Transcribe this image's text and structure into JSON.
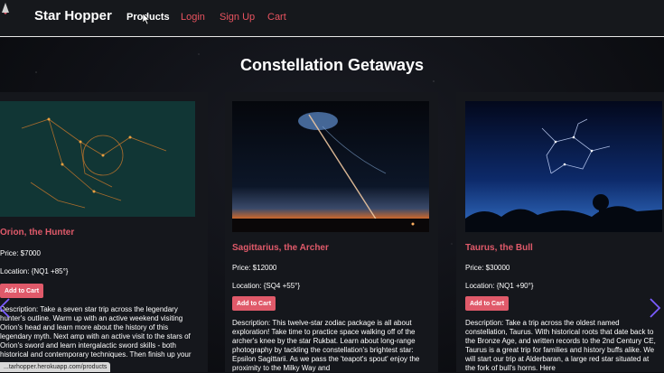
{
  "nav": {
    "brand": "Star Hopper",
    "links": [
      "Products",
      "Login",
      "Sign Up",
      "Cart"
    ],
    "active_index": 0
  },
  "page": {
    "title": "Constellation Getaways"
  },
  "products": [
    {
      "name": "Orion, the Hunter",
      "price": "Price: $7000",
      "location": "Location: {NQ1 +85°}",
      "button": "Add to Cart",
      "description": "Description: Take a seven star trip across the legendary hunter's outline. Warm up with an active weekend visiting Orion's head and learn more about the history of this legendary myth. Next amp with an active visit to the stars of Orion's sword and learn intergalactic sword skills - both historical and contemporary techniques. Then finish up your trip across Orion with three ... Belt exploring meteors"
    },
    {
      "name": "Sagittarius, the Archer",
      "price": "Price: $12000",
      "location": "Location: {SQ4 +55°}",
      "button": "Add to Cart",
      "description": "Description: This twelve-star zodiac package is all about exploration! Take time to practice space walking off of the archer's knee by the star Rukbat. Learn about long-range photography by tackling the constellation's brightest star: Epsilon Sagittarii. As we pass the 'teapot's spout' enjoy the proximity to the Milky Way and"
    },
    {
      "name": "Taurus, the Bull",
      "price": "Price: $30000",
      "location": "Location: {NQ1 +90°}",
      "button": "Add to Cart",
      "description": "Description: Take a trip across the oldest named constellation, Taurus. With historical roots that date back to the Bronze Age, and written records to the 2nd Century CE, Taurus is a great trip for families and history buffs alike. We will start our trip at Alderbaran, a large red star situated at the fork of bull's horns. Here"
    }
  ],
  "status_bar": {
    "url": "...tarhopper.herokuapp.com/products"
  },
  "colors": {
    "accent": "#e05a6a",
    "nav_bg": "#16181c",
    "card_bg": "#15171c",
    "arrow": "#7b5cff"
  }
}
